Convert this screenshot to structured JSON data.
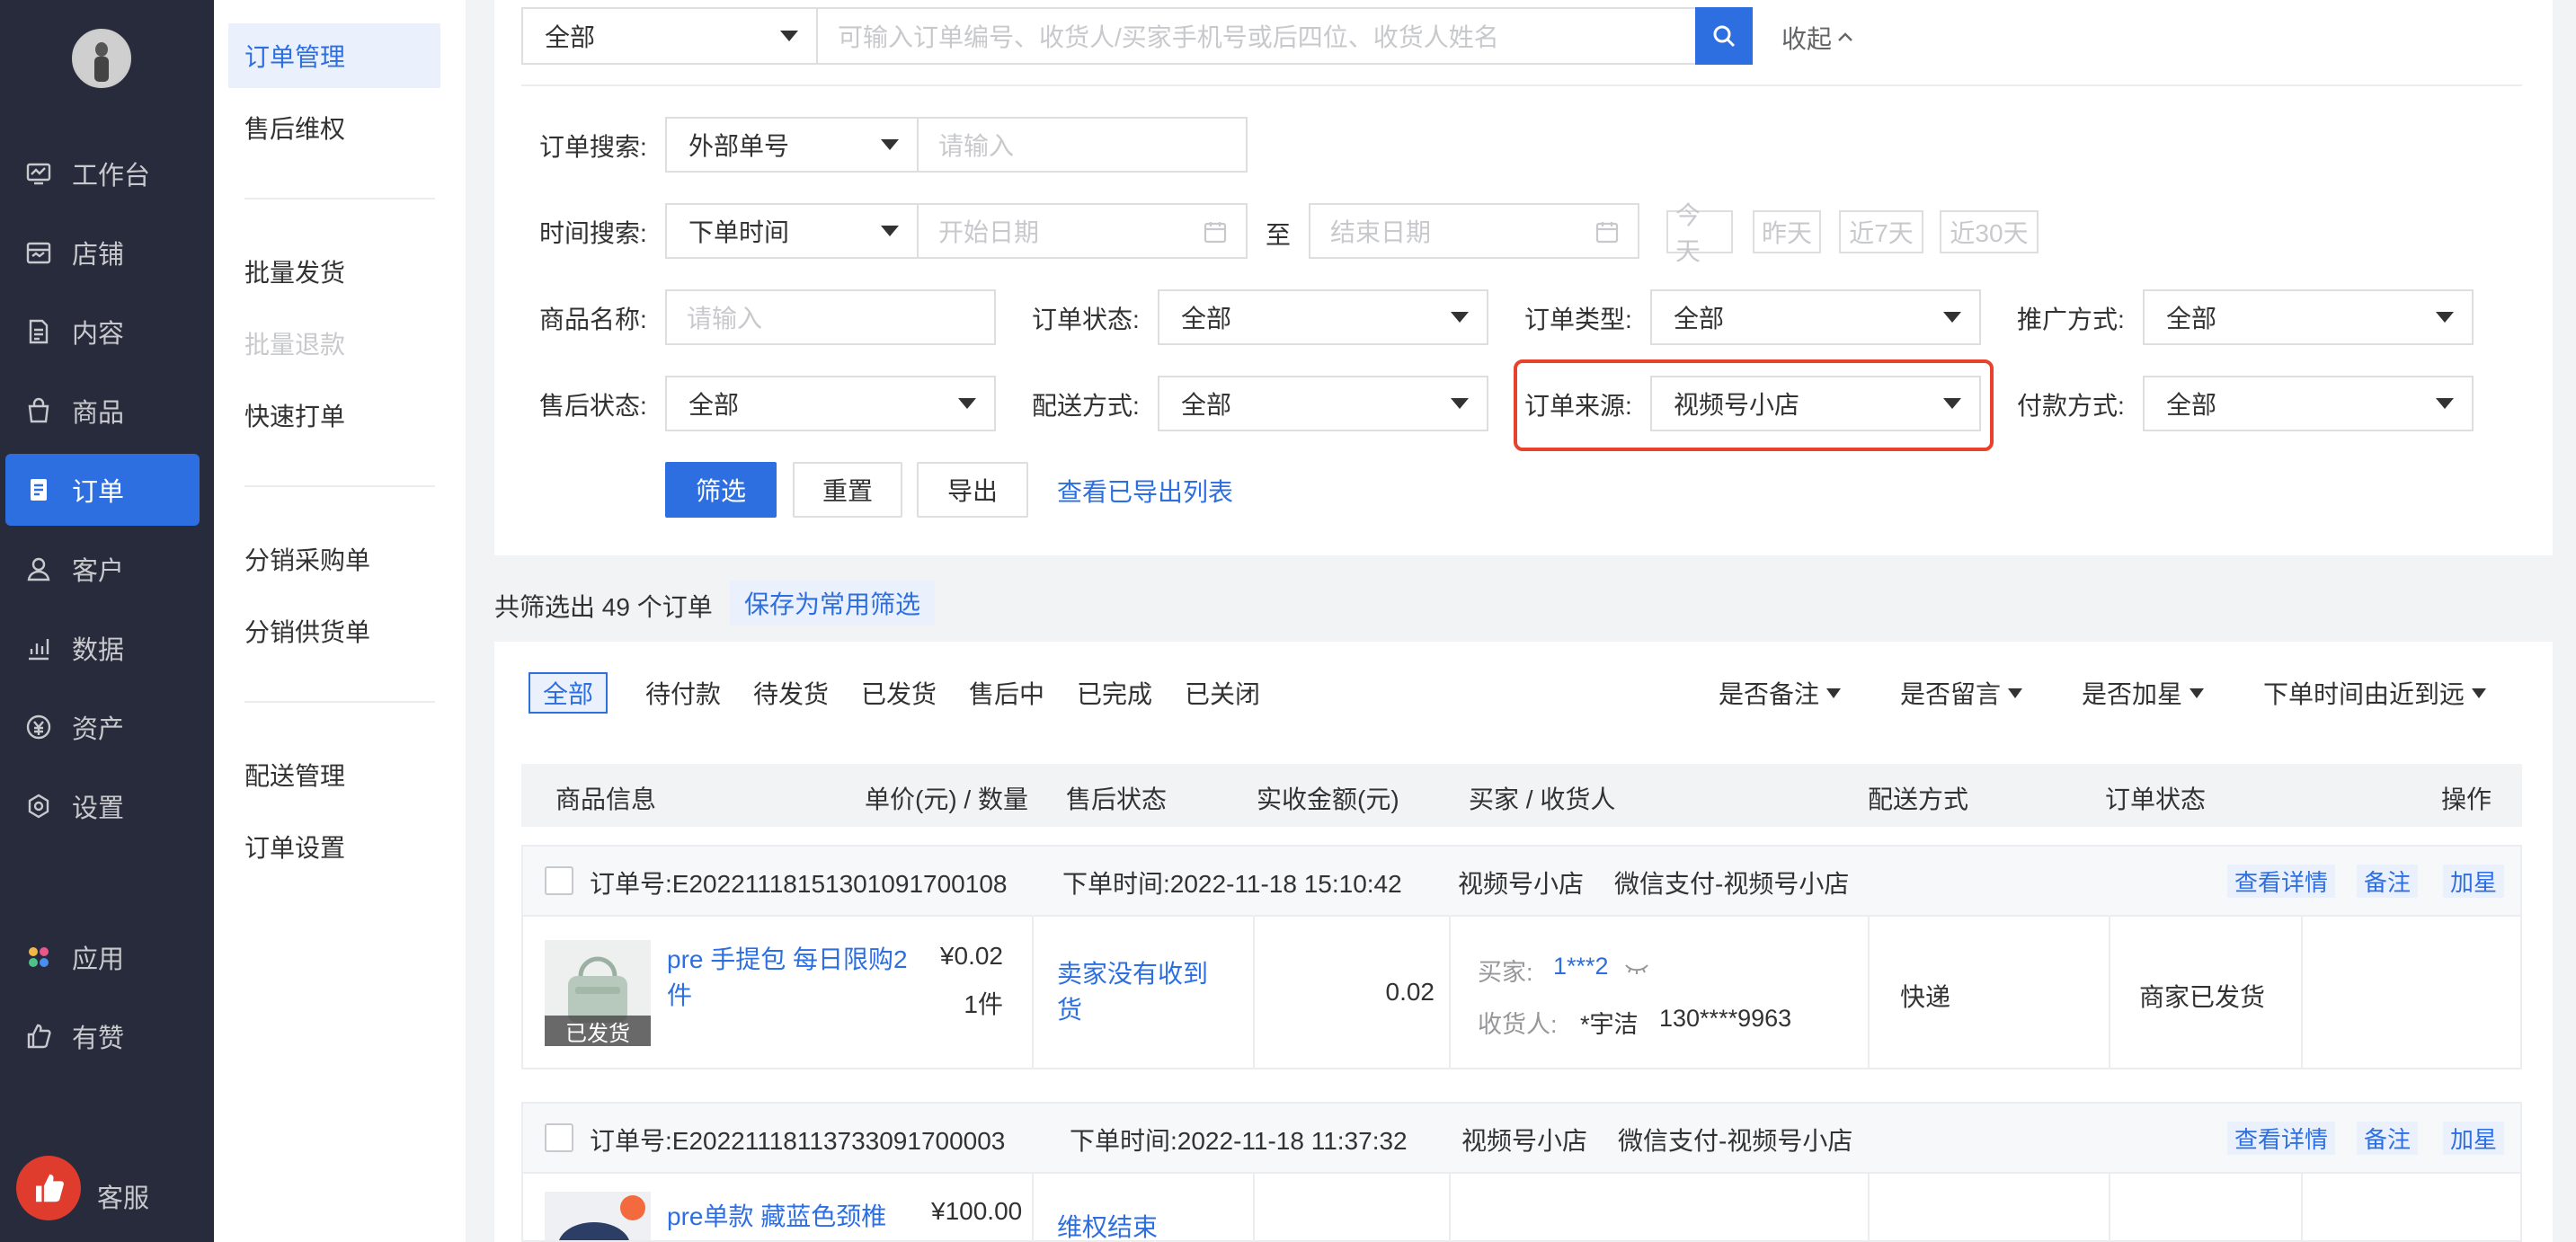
{
  "nav": {
    "items": [
      {
        "label": "工作台",
        "icon": "dashboard-icon"
      },
      {
        "label": "店铺",
        "icon": "store-icon"
      },
      {
        "label": "内容",
        "icon": "content-icon"
      },
      {
        "label": "商品",
        "icon": "goods-icon"
      },
      {
        "label": "订单",
        "icon": "order-icon",
        "active": true
      },
      {
        "label": "客户",
        "icon": "customer-icon"
      },
      {
        "label": "数据",
        "icon": "data-icon"
      },
      {
        "label": "资产",
        "icon": "asset-icon"
      },
      {
        "label": "设置",
        "icon": "settings-icon"
      },
      {
        "label": "应用",
        "icon": "apps-icon"
      },
      {
        "label": "有赞",
        "icon": "youzan-icon"
      }
    ],
    "kefu": "客服"
  },
  "subnav": {
    "items": [
      "订单管理",
      "售后维权",
      "批量发货",
      "批量退款",
      "快速打单",
      "分销采购单",
      "分销供货单",
      "配送管理",
      "订单设置"
    ]
  },
  "search": {
    "scope": "全部",
    "placeholder": "可输入订单编号、收货人/买家手机号或后四位、收货人姓名",
    "collapse": "收起"
  },
  "filters": {
    "order_search_label": "订单搜索:",
    "order_search_type": "外部单号",
    "order_search_placeholder": "请输入",
    "time_label": "时间搜索:",
    "time_type": "下单时间",
    "start_placeholder": "开始日期",
    "to": "至",
    "end_placeholder": "结束日期",
    "quick": [
      "今天",
      "昨天",
      "近7天",
      "近30天"
    ],
    "goods_name_label": "商品名称:",
    "goods_name_placeholder": "请输入",
    "order_status_label": "订单状态:",
    "order_status": "全部",
    "order_type_label": "订单类型:",
    "order_type": "全部",
    "promo_label": "推广方式:",
    "promo": "全部",
    "aftersale_label": "售后状态:",
    "aftersale": "全部",
    "delivery_label": "配送方式:",
    "delivery": "全部",
    "source_label": "订单来源:",
    "source": "视频号小店",
    "pay_label": "付款方式:",
    "pay": "全部",
    "btn_filter": "筛选",
    "btn_reset": "重置",
    "btn_export": "导出",
    "view_exported": "查看已导出列表",
    "highlight_color": "#e8412c"
  },
  "summary": {
    "text": "共筛选出 49 个订单",
    "save": "保存为常用筛选"
  },
  "tabs": [
    "全部",
    "待付款",
    "待发货",
    "已发货",
    "售后中",
    "已完成",
    "已关闭"
  ],
  "sorts": [
    "是否备注",
    "是否留言",
    "是否加星",
    "下单时间由近到远"
  ],
  "table_headers": [
    "商品信息",
    "单价(元) / 数量",
    "售后状态",
    "实收金额(元)",
    "买家 / 收货人",
    "配送方式",
    "订单状态",
    "操作"
  ],
  "orders": [
    {
      "no": "订单号:E20221118151301091700108",
      "time": "下单时间:2022-11-18 15:10:42",
      "channel": "视频号小店",
      "pay": "微信支付-视频号小店",
      "actions": [
        "查看详情",
        "备注",
        "加星"
      ],
      "goods": "pre 手提包 每日限购2件",
      "goods_badge": "已发货",
      "price": "¥0.02",
      "qty": "1件",
      "aftersale": "卖家没有收到货",
      "amount": "0.02",
      "buyer_label": "买家:",
      "buyer": "1***2",
      "receiver_label": "收货人:",
      "receiver": "*宇洁",
      "phone": "130****9963",
      "delivery": "快递",
      "status": "商家已发货"
    },
    {
      "no": "订单号:E20221118113733091700003",
      "time": "下单时间:2022-11-18 11:37:32",
      "channel": "视频号小店",
      "pay": "微信支付-视频号小店",
      "actions": [
        "查看详情",
        "备注",
        "加星"
      ],
      "goods": "pre单款 藏蓝色颈椎",
      "price": "¥100.00",
      "aftersale": "维权结束"
    }
  ]
}
